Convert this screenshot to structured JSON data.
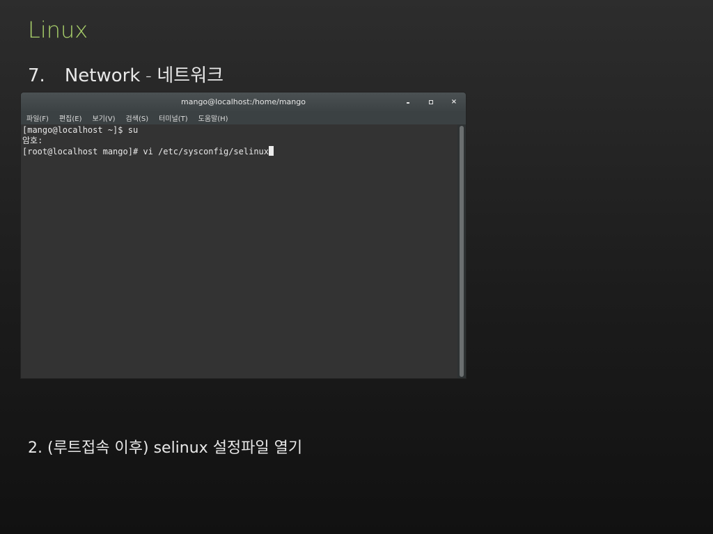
{
  "slide": {
    "title": "Linux",
    "subtitle_number": "7.",
    "subtitle_text": "Network",
    "subtitle_dash": "–",
    "subtitle_korean": "네트워크",
    "caption": "2. (루트접속 이후) selinux 설정파일 열기"
  },
  "terminal": {
    "window_title": "mango@localhost:/home/mango",
    "menu": [
      {
        "label": "파일(F)"
      },
      {
        "label": "편집(E)"
      },
      {
        "label": "보기(V)"
      },
      {
        "label": "검색(S)"
      },
      {
        "label": "터미널(T)"
      },
      {
        "label": "도움말(H)"
      }
    ],
    "lines": [
      "[mango@localhost ~]$ su",
      "암호:",
      "[root@localhost mango]# vi /etc/sysconfig/selinux"
    ],
    "buttons": {
      "minimize_icon": "minimize-icon",
      "maximize_icon": "maximize-icon",
      "close_icon": "close-icon",
      "close_glyph": "×"
    }
  },
  "colors": {
    "title_accent": "#a8cf6a",
    "terminal_bg": "#333333",
    "titlebar_bg": "#4b5153"
  }
}
